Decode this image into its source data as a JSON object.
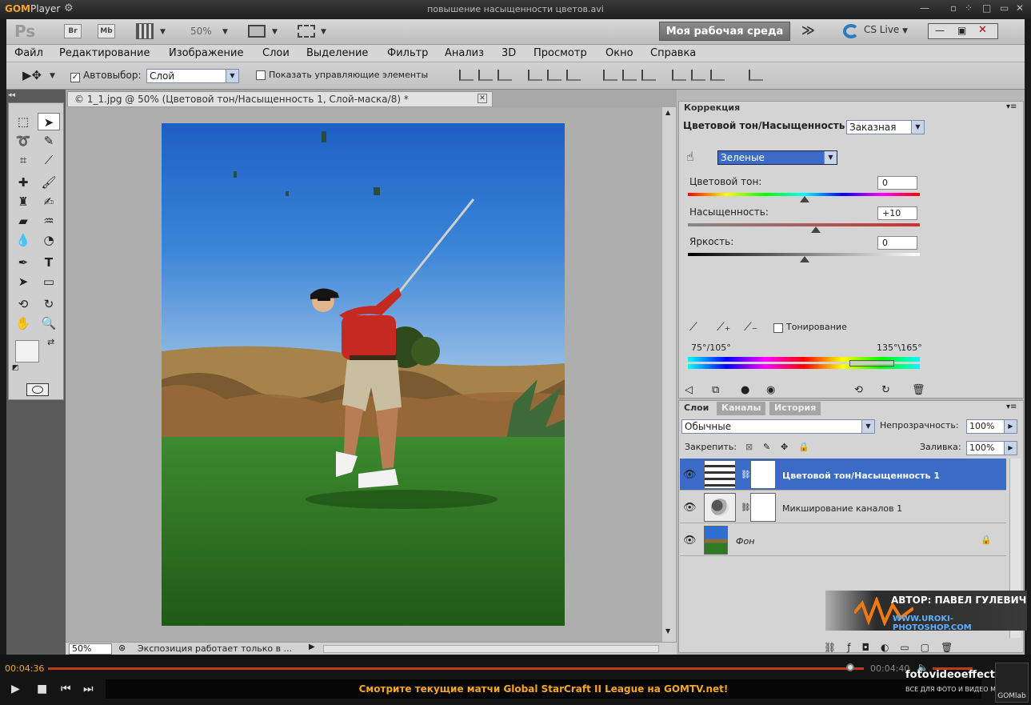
{
  "player": {
    "logo_main": "GOM",
    "logo_sub": "Player",
    "window_title": "повышение насыщенности цветов.avi",
    "time_current": "00:04:36",
    "time_total": "00:04:40",
    "progress": 0.985,
    "ticker": "Смотрите текущие матчи Global StarCraft II League на GOMTV.net!",
    "lab_label": "GOMlab",
    "site_overlay": "fotovideoeffect.com",
    "site_sub": "ВСЕ ДЛЯ ФОТО И ВИДЕО МОНТАЖА!"
  },
  "ps": {
    "logo": "Ps",
    "bridge": "Br",
    "minibridge": "Mb",
    "zoom": "50%",
    "workspace": "Моя рабочая среда",
    "cslive": "CS Live",
    "menu": [
      "Файл",
      "Редактирование",
      "Изображение",
      "Слои",
      "Выделение",
      "Фильтр",
      "Анализ",
      "3D",
      "Просмотр",
      "Окно",
      "Справка"
    ],
    "options": {
      "autoselect_label": "Автовыбор:",
      "autoselect_value": "Слой",
      "show_controls": "Показать управляющие элементы"
    },
    "doc_tab": "1_1.jpg @ 50% (Цветовой тон/Насыщенность 1, Слой-маска/8) *",
    "status": {
      "zoom": "50%",
      "text": "Экспозиция работает только в ..."
    }
  },
  "correction": {
    "tab": "Коррекция",
    "title": "Цветовой тон/Насыщенность",
    "preset": "Заказная",
    "channel": "Зеленые",
    "hue_label": "Цветовой тон:",
    "hue_value": "0",
    "sat_label": "Насыщенность:",
    "sat_value": "+10",
    "light_label": "Яркость:",
    "light_value": "0",
    "colorize": "Тонирование",
    "range_left": "75°/105°",
    "range_right": "135°\\165°"
  },
  "layers_panel": {
    "tabs": [
      "Слои",
      "Каналы",
      "История"
    ],
    "blend_mode": "Обычные",
    "opacity_label": "Непрозрачность:",
    "opacity_value": "100%",
    "lock_label": "Закрепить:",
    "fill_label": "Заливка:",
    "fill_value": "100%",
    "layers": [
      {
        "name": "Цветовой тон/Насыщенность 1",
        "selected": true
      },
      {
        "name": "Микширование каналов 1",
        "selected": false
      },
      {
        "name": "Фон",
        "selected": false
      }
    ]
  },
  "watermark": {
    "author": "АВТОР: ПАВЕЛ ГУЛЕВИЧ",
    "site": "WWW.UROKI-PHOTOSHOP.COM"
  },
  "colors": {
    "accent_selected": "#3a6cc7",
    "gom_orange": "#f5a623"
  }
}
